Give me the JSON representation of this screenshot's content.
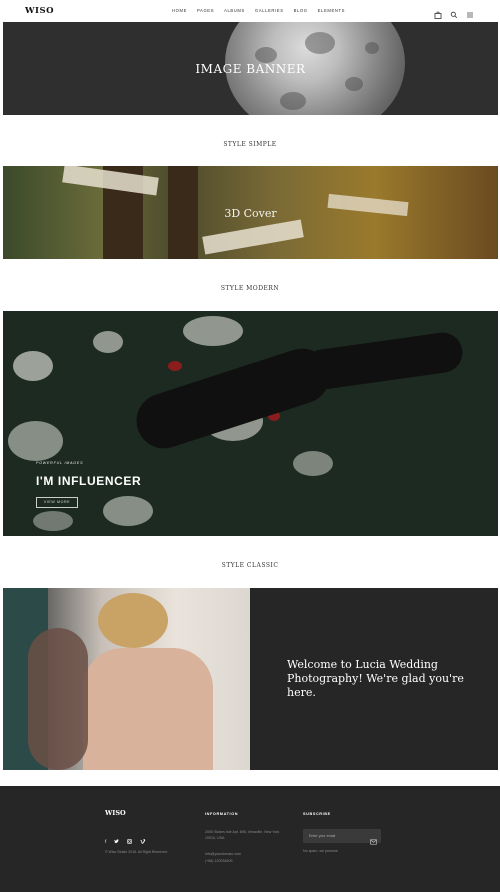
{
  "header": {
    "logo": "WISO",
    "nav": [
      "HOME",
      "PAGES",
      "ALBUMS",
      "GALLERIES",
      "BLOG",
      "ELEMENTS"
    ],
    "icons": [
      "bag-icon",
      "search-icon",
      "menu-icon"
    ]
  },
  "banner_image": {
    "title": "IMAGE BANNER"
  },
  "style_simple": {
    "label": "STYLE SIMPLE",
    "title": "3D Cover"
  },
  "style_modern": {
    "label": "STYLE MODERN",
    "overline": "POWERFUL IMAGES",
    "title": "I'M INFLUENCER",
    "button": "VIEW MORE"
  },
  "style_classic": {
    "label": "STYLE CLASSIC",
    "text": "Welcome to Lucia Wedding Photography! We're glad you're here."
  },
  "footer": {
    "logo": "WISO",
    "copyright": "© Wiso Studio 2018. All Right Reserved.",
    "information_heading": "INFORMATION",
    "address": "2005 Stokes Isle Apt. 896, Venaville, New York 10010, USA",
    "email": "info@yourdomain.com",
    "phone": "(+68) 120034509",
    "subscribe_heading": "SUBSCRIBE",
    "email_placeholder": "Enter your email",
    "subscribe_note": "No spam, we promise",
    "social": [
      "f",
      "t",
      "ig",
      "vimeo"
    ]
  },
  "colors": {
    "dark_bg": "#262626",
    "banner_bg": "#2f2f2f"
  }
}
